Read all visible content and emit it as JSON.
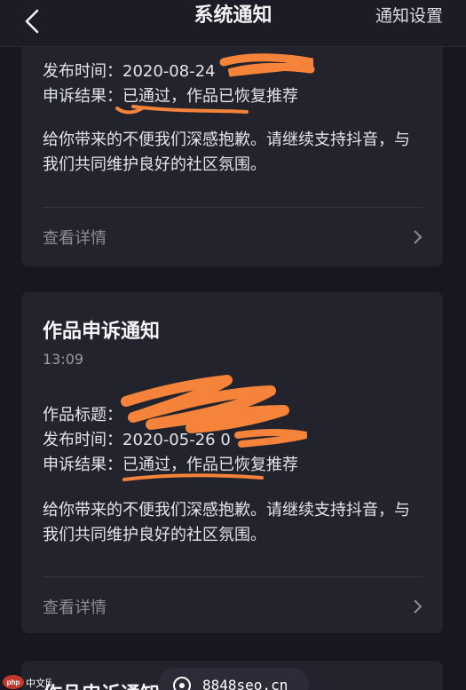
{
  "header": {
    "title": "系统通知",
    "action_label": "通知设置"
  },
  "notifications": [
    {
      "publish_time_label": "发布时间：",
      "publish_time_value": "2020-08-24",
      "result_label": "申诉结果：",
      "result_value": "已通过，作品已恢复推荐",
      "body": "给你带来的不便我们深感抱歉。请继续支持抖音，与我们共同维护良好的社区氛围。",
      "detail_label": "查看详情"
    },
    {
      "title": "作品申诉通知",
      "time": "13:09",
      "work_title_label": "作品标题：",
      "publish_time_label": "发布时间：",
      "publish_time_value": "2020-05-26 0",
      "result_label": "申诉结果：",
      "result_value": "已通过，作品已恢复推荐",
      "body": "给你带来的不便我们深感抱歉。请继续支持抖音，与我们共同维护良好的社区氛围。",
      "detail_label": "查看详情"
    },
    {
      "title": "作品申诉通知"
    }
  ],
  "watermark": {
    "logo_text": "php 中文网",
    "site_text": "8848seo.cn"
  },
  "colors": {
    "background": "#17171f",
    "card": "#22232d",
    "annotation_orange": "#f5833a"
  }
}
